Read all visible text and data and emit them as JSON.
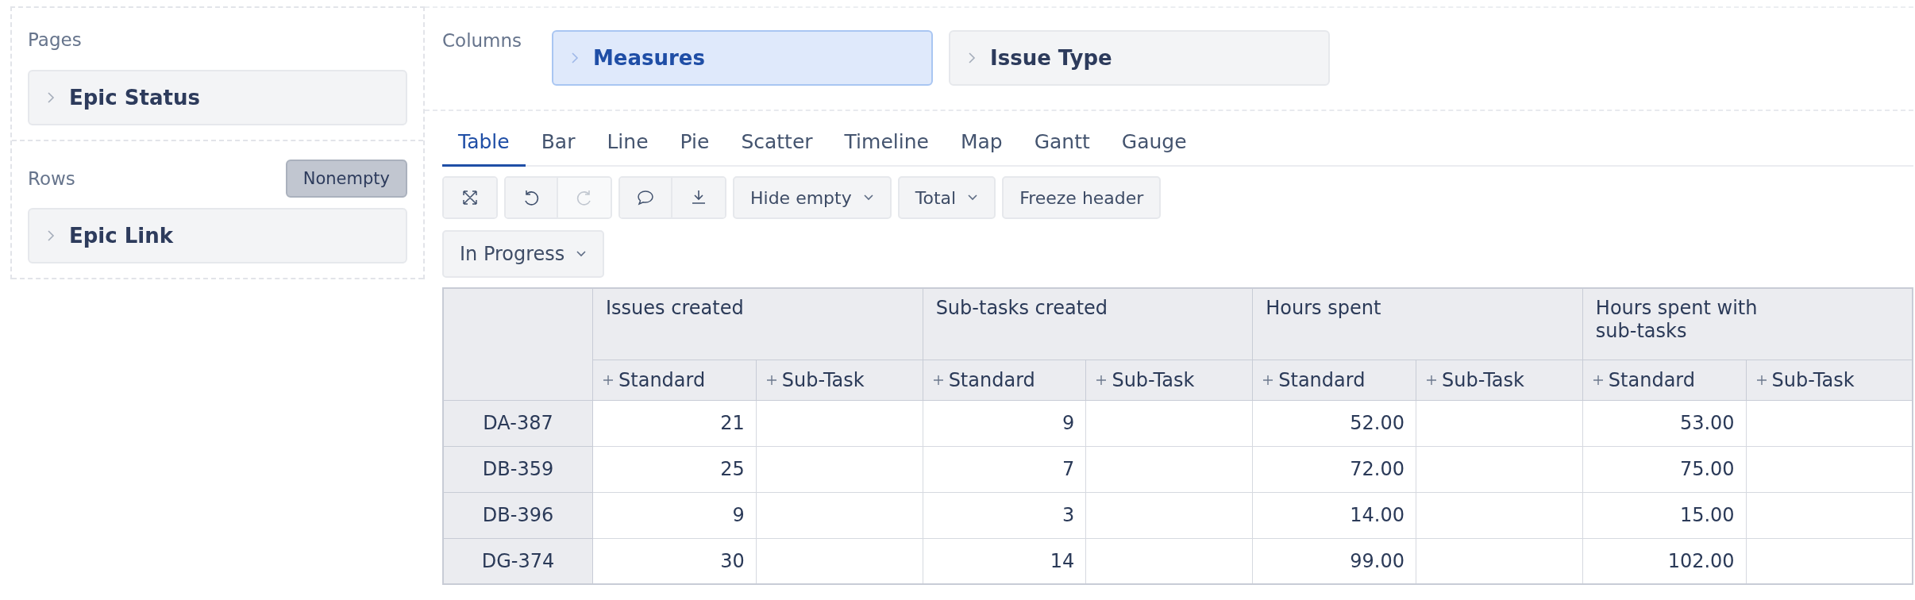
{
  "pages": {
    "label": "Pages",
    "items": [
      {
        "label": "Epic Status"
      }
    ]
  },
  "rows_panel": {
    "label": "Rows",
    "nonempty": {
      "label": "Nonempty",
      "on": true
    },
    "items": [
      {
        "label": "Epic Link"
      }
    ]
  },
  "columns_panel": {
    "label": "Columns",
    "items": [
      {
        "label": "Measures",
        "selected": true
      },
      {
        "label": "Issue Type",
        "selected": false
      }
    ]
  },
  "view_tabs": [
    {
      "label": "Table",
      "selected": true
    },
    {
      "label": "Bar",
      "selected": false
    },
    {
      "label": "Line",
      "selected": false
    },
    {
      "label": "Pie",
      "selected": false
    },
    {
      "label": "Scatter",
      "selected": false
    },
    {
      "label": "Timeline",
      "selected": false
    },
    {
      "label": "Map",
      "selected": false
    },
    {
      "label": "Gantt",
      "selected": false
    },
    {
      "label": "Gauge",
      "selected": false
    }
  ],
  "toolbar": {
    "icon_groups": [
      [
        {
          "kind": "fullscreen",
          "disabled": false
        }
      ],
      [
        {
          "kind": "undo",
          "disabled": false
        },
        {
          "kind": "redo",
          "disabled": true
        }
      ],
      [
        {
          "kind": "comment",
          "disabled": false
        },
        {
          "kind": "export",
          "disabled": false
        }
      ]
    ],
    "buttons": [
      {
        "label": "Hide empty",
        "kind": "dropdown"
      },
      {
        "label": "Total",
        "kind": "dropdown"
      },
      {
        "label": "Freeze header",
        "kind": "button"
      }
    ]
  },
  "filter": {
    "label": "In Progress"
  },
  "table": {
    "measures": [
      {
        "label": "Issues created",
        "subcolumns": [
          "Standard",
          "Sub-Task"
        ]
      },
      {
        "label": "Sub-tasks created",
        "subcolumns": [
          "Standard",
          "Sub-Task"
        ]
      },
      {
        "label": "Hours spent",
        "subcolumns": [
          "Standard",
          "Sub-Task"
        ]
      },
      {
        "label": "Hours spent with sub-tasks",
        "subcolumns": [
          "Standard",
          "Sub-Task"
        ]
      }
    ],
    "rows": [
      {
        "label": "DA-387",
        "cells": [
          "21",
          null,
          "9",
          null,
          "52.00",
          null,
          "53.00",
          null
        ]
      },
      {
        "label": "DB-359",
        "cells": [
          "25",
          null,
          "7",
          null,
          "72.00",
          null,
          "75.00",
          null
        ]
      },
      {
        "label": "DB-396",
        "cells": [
          "9",
          null,
          "3",
          null,
          "14.00",
          null,
          "15.00",
          null
        ]
      },
      {
        "label": "DG-374",
        "cells": [
          "30",
          null,
          "14",
          null,
          "99.00",
          null,
          "102.00",
          null
        ]
      }
    ]
  }
}
